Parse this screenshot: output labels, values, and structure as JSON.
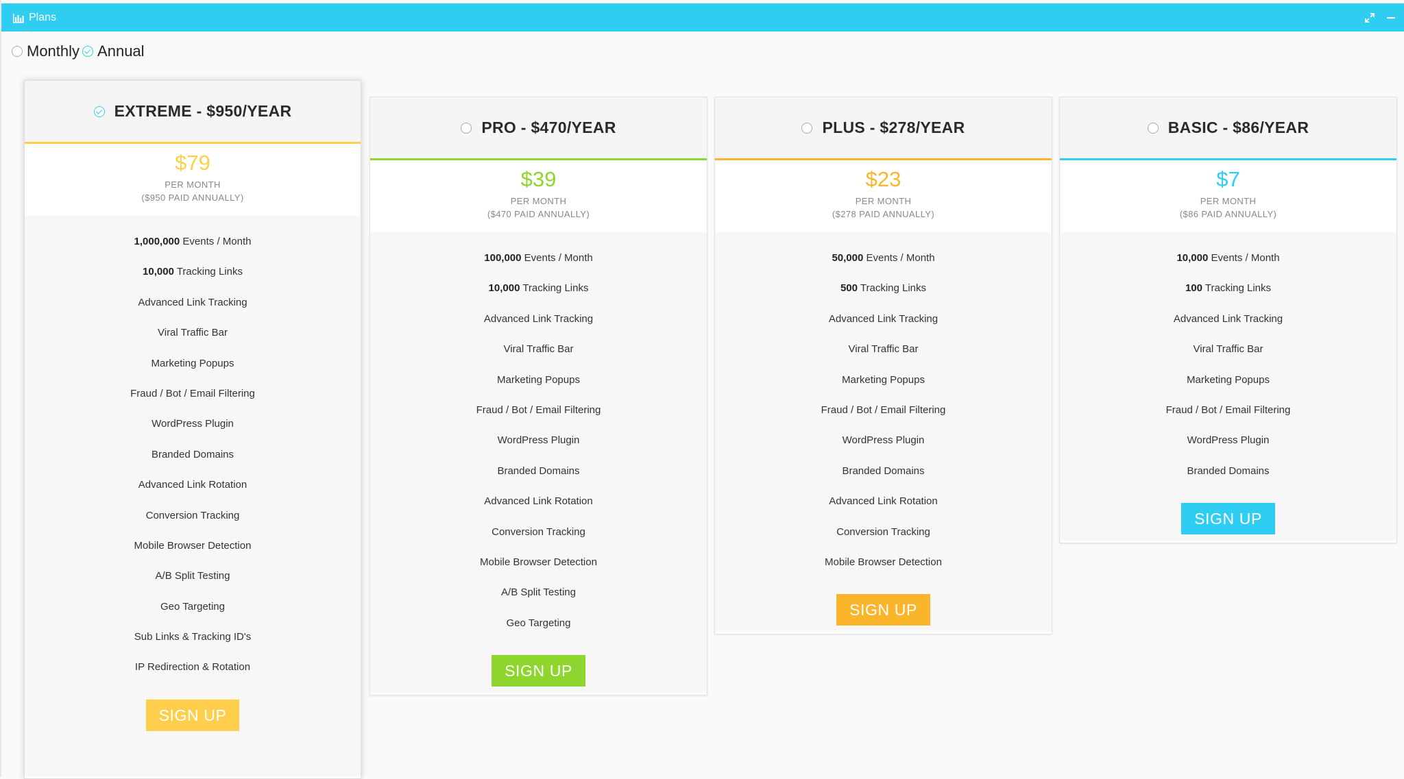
{
  "window": {
    "title": "Plans"
  },
  "billing": {
    "monthly_label": "Monthly",
    "annual_label": "Annual",
    "selected": "annual"
  },
  "plans": [
    {
      "name": "EXTREME - $950/YEAR",
      "selected": true,
      "accent": "#ffcf4c",
      "price": "$79",
      "per_label": "PER MONTH",
      "paid_label": "($950 PAID ANNUALLY)",
      "features": [
        {
          "bold": "1,000,000",
          "text": " Events / Month"
        },
        {
          "bold": "10,000",
          "text": " Tracking Links"
        },
        {
          "bold": "",
          "text": "Advanced Link Tracking"
        },
        {
          "bold": "",
          "text": "Viral Traffic Bar"
        },
        {
          "bold": "",
          "text": "Marketing Popups"
        },
        {
          "bold": "",
          "text": "Fraud / Bot / Email Filtering"
        },
        {
          "bold": "",
          "text": "WordPress Plugin"
        },
        {
          "bold": "",
          "text": "Branded Domains"
        },
        {
          "bold": "",
          "text": "Advanced Link Rotation"
        },
        {
          "bold": "",
          "text": "Conversion Tracking"
        },
        {
          "bold": "",
          "text": "Mobile Browser Detection"
        },
        {
          "bold": "",
          "text": "A/B Split Testing"
        },
        {
          "bold": "",
          "text": "Geo Targeting"
        },
        {
          "bold": "",
          "text": "Sub Links & Tracking ID's"
        },
        {
          "bold": "",
          "text": "IP Redirection & Rotation"
        }
      ],
      "button_label": "SIGN UP"
    },
    {
      "name": "PRO - $470/YEAR",
      "selected": false,
      "accent": "#8ed52d",
      "price": "$39",
      "per_label": "PER MONTH",
      "paid_label": "($470 PAID ANNUALLY)",
      "features": [
        {
          "bold": "100,000",
          "text": " Events / Month"
        },
        {
          "bold": "10,000",
          "text": " Tracking Links"
        },
        {
          "bold": "",
          "text": "Advanced Link Tracking"
        },
        {
          "bold": "",
          "text": "Viral Traffic Bar"
        },
        {
          "bold": "",
          "text": "Marketing Popups"
        },
        {
          "bold": "",
          "text": "Fraud / Bot / Email Filtering"
        },
        {
          "bold": "",
          "text": "WordPress Plugin"
        },
        {
          "bold": "",
          "text": "Branded Domains"
        },
        {
          "bold": "",
          "text": "Advanced Link Rotation"
        },
        {
          "bold": "",
          "text": "Conversion Tracking"
        },
        {
          "bold": "",
          "text": "Mobile Browser Detection"
        },
        {
          "bold": "",
          "text": "A/B Split Testing"
        },
        {
          "bold": "",
          "text": "Geo Targeting"
        }
      ],
      "button_label": "SIGN UP"
    },
    {
      "name": "PLUS - $278/YEAR",
      "selected": false,
      "accent": "#fbb52b",
      "price": "$23",
      "per_label": "PER MONTH",
      "paid_label": "($278 PAID ANNUALLY)",
      "features": [
        {
          "bold": "50,000",
          "text": " Events / Month"
        },
        {
          "bold": "500",
          "text": " Tracking Links"
        },
        {
          "bold": "",
          "text": "Advanced Link Tracking"
        },
        {
          "bold": "",
          "text": "Viral Traffic Bar"
        },
        {
          "bold": "",
          "text": "Marketing Popups"
        },
        {
          "bold": "",
          "text": "Fraud / Bot / Email Filtering"
        },
        {
          "bold": "",
          "text": "WordPress Plugin"
        },
        {
          "bold": "",
          "text": "Branded Domains"
        },
        {
          "bold": "",
          "text": "Advanced Link Rotation"
        },
        {
          "bold": "",
          "text": "Conversion Tracking"
        },
        {
          "bold": "",
          "text": "Mobile Browser Detection"
        }
      ],
      "button_label": "SIGN UP"
    },
    {
      "name": "BASIC - $86/YEAR",
      "selected": false,
      "accent": "#30cdf2",
      "price": "$7",
      "per_label": "PER MONTH",
      "paid_label": "($86 PAID ANNUALLY)",
      "features": [
        {
          "bold": "10,000",
          "text": " Events / Month"
        },
        {
          "bold": "100",
          "text": " Tracking Links"
        },
        {
          "bold": "",
          "text": "Advanced Link Tracking"
        },
        {
          "bold": "",
          "text": "Viral Traffic Bar"
        },
        {
          "bold": "",
          "text": "Marketing Popups"
        },
        {
          "bold": "",
          "text": "Fraud / Bot / Email Filtering"
        },
        {
          "bold": "",
          "text": "WordPress Plugin"
        },
        {
          "bold": "",
          "text": "Branded Domains"
        }
      ],
      "button_label": "SIGN UP"
    }
  ]
}
